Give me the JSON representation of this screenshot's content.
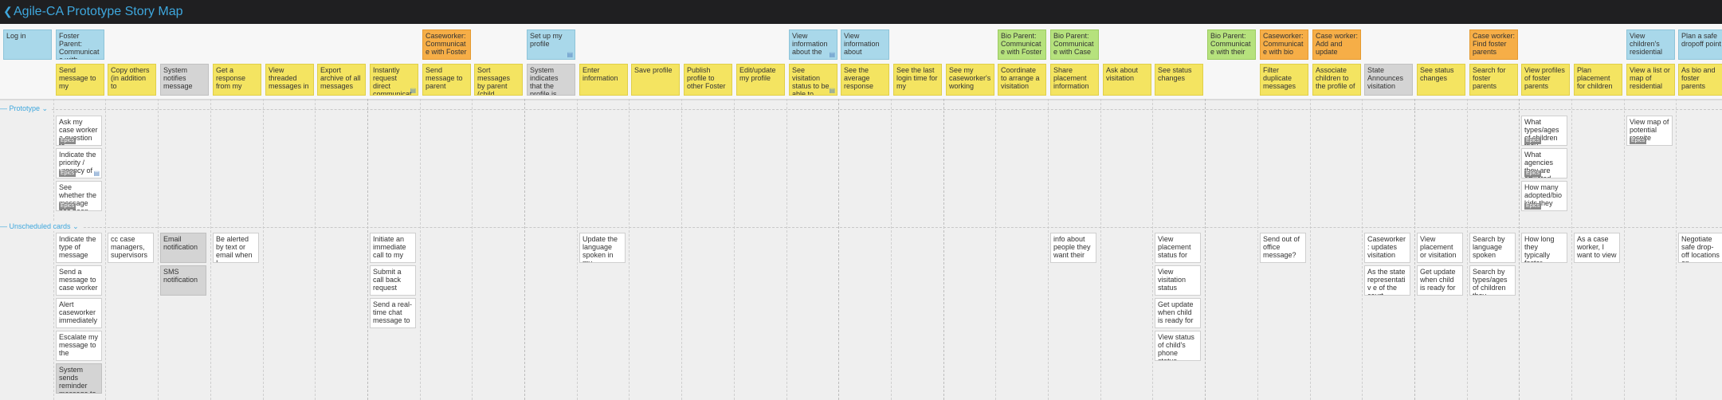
{
  "header": {
    "back_icon": "chevron-left-icon",
    "title": "Agile-CA Prototype Story Map"
  },
  "lanes": {
    "prototype": "Prototype",
    "unscheduled": "Unscheduled cards"
  },
  "colors": {
    "activity_blue": "#a9d8ea",
    "activity_orange": "#f6ae47",
    "activity_green": "#b6e27d",
    "story_yellow": "#f4e461",
    "story_gray": "#d4d4d4",
    "story_white": "#ffffff",
    "accent": "#3ea7dd"
  },
  "activities": [
    {
      "text": "Log in",
      "color": "blue"
    },
    {
      "text": "Foster Parent: Communicate with",
      "color": "blue"
    },
    {
      "text": "Caseworker: Communicate with Foster",
      "color": "orange"
    },
    {
      "text": "Set up my profile",
      "color": "blue"
    },
    {
      "text": "View information about the",
      "color": "blue"
    },
    {
      "text": "View information about",
      "color": "blue"
    },
    {
      "text": "Bio Parent: Communicate with Foster",
      "color": "green"
    },
    {
      "text": "Bio Parent: Communicate with Case",
      "color": "green"
    },
    {
      "text": "Bio Parent: Communicate with their",
      "color": "green"
    },
    {
      "text": "Caseworker: Communicate with bio",
      "color": "orange"
    },
    {
      "text": "Case worker: Add and update",
      "color": "orange"
    },
    {
      "text": "Case worker: Find foster parents",
      "color": "orange"
    },
    {
      "text": "View children's residential",
      "color": "blue"
    },
    {
      "text": "Plan a safe dropoff point",
      "color": "blue"
    }
  ],
  "stories": [
    {
      "text": "Send message to my",
      "color": "yellow"
    },
    {
      "text": "Copy others (in addition to",
      "color": "yellow"
    },
    {
      "text": "System notifies message",
      "color": "gray"
    },
    {
      "text": "Get a response from my",
      "color": "yellow"
    },
    {
      "text": "View threaded messages in",
      "color": "yellow"
    },
    {
      "text": "Export archive of all messages",
      "color": "yellow"
    },
    {
      "text": "Instantly request direct communicat",
      "color": "yellow"
    },
    {
      "text": "Send message to parent",
      "color": "yellow"
    },
    {
      "text": "Sort messages by parent (child",
      "color": "yellow"
    },
    {
      "text": "System indicates that the profile is",
      "color": "gray"
    },
    {
      "text": "Enter information",
      "color": "yellow"
    },
    {
      "text": "Save profile",
      "color": "yellow"
    },
    {
      "text": "Publish profile to other Foster",
      "color": "yellow"
    },
    {
      "text": "Edit/update my profile",
      "color": "yellow"
    },
    {
      "text": "See visitation status to be able to",
      "color": "yellow"
    },
    {
      "text": "See the average response",
      "color": "yellow"
    },
    {
      "text": "See the last login time for my",
      "color": "yellow"
    },
    {
      "text": "See my caseworker's working",
      "color": "yellow"
    },
    {
      "text": "Coordinate to arrange a visitation",
      "color": "yellow"
    },
    {
      "text": "Share placement information",
      "color": "yellow"
    },
    {
      "text": "Ask about visitation",
      "color": "yellow"
    },
    {
      "text": "See status changes",
      "color": "yellow"
    },
    {
      "text": "Filter duplicate messages",
      "color": "yellow"
    },
    {
      "text": "Associate children to the profile of",
      "color": "yellow"
    },
    {
      "text": "State Announces visitation",
      "color": "gray"
    },
    {
      "text": "See status changes",
      "color": "yellow"
    },
    {
      "text": "Search for foster parents",
      "color": "yellow"
    },
    {
      "text": "View profiles of foster parents",
      "color": "yellow"
    },
    {
      "text": "Plan placement for children",
      "color": "yellow"
    },
    {
      "text": "View a list or map of residential",
      "color": "yellow"
    },
    {
      "text": "As bio and foster parents",
      "color": "yellow"
    }
  ],
  "prototype_cards": [
    {
      "text": "Ask my case worker a question to",
      "color": "white",
      "tag": "Epics"
    },
    {
      "text": "Indicate the priority / urgency of",
      "color": "white",
      "tag": "Epics"
    },
    {
      "text": "See whether the message has been",
      "color": "white",
      "tag": "Epics"
    },
    {
      "text": "What types/ages of children they",
      "color": "white",
      "tag": "Epics"
    },
    {
      "text": "What agencies they are affiliated",
      "color": "white",
      "tag": "Epics"
    },
    {
      "text": "How many adopted/bio kids they",
      "color": "white",
      "tag": "Epics"
    },
    {
      "text": "View map of potential respite",
      "color": "white",
      "tag": "Epics"
    }
  ],
  "unscheduled_cards": [
    {
      "text": "Indicate the type of message",
      "color": "white"
    },
    {
      "text": "Send a message to case worker",
      "color": "white"
    },
    {
      "text": "Alert caseworker immediately",
      "color": "white"
    },
    {
      "text": "Escalate my message to the",
      "color": "white"
    },
    {
      "text": "System sends reminder message to",
      "color": "gray"
    },
    {
      "text": "cc case managers, supervisors",
      "color": "white"
    },
    {
      "text": "Email notification",
      "color": "gray"
    },
    {
      "text": "SMS notification",
      "color": "gray"
    },
    {
      "text": "Be alerted by text or email when I",
      "color": "white"
    },
    {
      "text": "Initiate an immediate call to my",
      "color": "white"
    },
    {
      "text": "Submit a call back request",
      "color": "white"
    },
    {
      "text": "Send a real-time chat message to",
      "color": "white"
    },
    {
      "text": "Update the language spoken in my",
      "color": "white"
    },
    {
      "text": "info about people they want their",
      "color": "white"
    },
    {
      "text": "View placement status for",
      "color": "white"
    },
    {
      "text": "View visitation status",
      "color": "white"
    },
    {
      "text": "Get update when child is ready for",
      "color": "white"
    },
    {
      "text": "View status of child's phone status",
      "color": "white"
    },
    {
      "text": "Send out of office message?",
      "color": "white"
    },
    {
      "text": "Caseworker: updates visitation",
      "color": "white"
    },
    {
      "text": "As the state representativ e of the court",
      "color": "white"
    },
    {
      "text": "View placement or visitation",
      "color": "white"
    },
    {
      "text": "Get update when child is ready for",
      "color": "white"
    },
    {
      "text": "Search by language spoken",
      "color": "white"
    },
    {
      "text": "Search by types/ages of children they",
      "color": "white"
    },
    {
      "text": "How long they typically foster",
      "color": "white"
    },
    {
      "text": "As a case worker, I want to view",
      "color": "white"
    },
    {
      "text": "Negotiate safe drop-off locations on",
      "color": "white"
    }
  ]
}
